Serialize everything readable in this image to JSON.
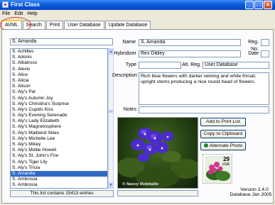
{
  "window": {
    "title": "First Class"
  },
  "menu": [
    "File",
    "Edit",
    "Help"
  ],
  "tabs": [
    "AVML",
    "Search",
    "Print",
    "User Database",
    "Update Database"
  ],
  "search": {
    "value": "S. Amanda"
  },
  "list": {
    "items": [
      "S. Achilles",
      "S. Adonis",
      "S. Albatross",
      "S. Alexis",
      "S. Alice",
      "S. Alicia",
      "S. Alison",
      "S. Aly's Pal",
      "S. Aly's Autumn Joy",
      "S. Aly's Christina's Surprise",
      "S. Aly's Cupids Kiss",
      "S. Aly's Evening Serenade",
      "S. Aly's Lady Elizabeth",
      "S. Aly's Magnetosphere",
      "S. Aly's Maitland Skies",
      "S. Aly's Michelle Lee",
      "S. Aly's Mikey",
      "S. Aly's Mollie Howell",
      "S. Aly's St. John's Fire",
      "S. Aly's Tiger Lily",
      "S. Aly's Tricia",
      "S. Amanda",
      "S. Ambrosia",
      "S. Ambrosia",
      "S. Amethyst"
    ],
    "selected_index": 21,
    "count_text": "This list contains 15413 entries"
  },
  "fields": {
    "name_label": "Name",
    "name": "S. Amanda",
    "reg_no_label": "Reg. No.",
    "reg_no": "",
    "hybridizer_label": "Hybridizer",
    "hybridizer": "Rex Dibley",
    "date_label": "Date",
    "date": "",
    "type_label": "Type",
    "type": "",
    "alt_reg_label": "Alt. Reg.",
    "alt_reg": "User Database",
    "description_label": "Description",
    "description": "Rich blue flowers with darker veining and white throat; upright stems producing a nice round head of flowers.",
    "notes_label": "Notes",
    "notes": ""
  },
  "photo": {
    "caption": "© Nancy Robitaille"
  },
  "buttons": {
    "add_print": "Add to Print List",
    "copy_clipboard": "Copy to Clipboard",
    "alt_photo": "Alternate Photo"
  },
  "stamp": {
    "value": "29",
    "country": "USA"
  },
  "version": {
    "version": "Version 2.4.0",
    "database": "Database Jan 2005"
  },
  "colors": {
    "selection": "#316ac5",
    "flower": "#4b2bd0",
    "titlebar": "#0a5bd8",
    "circle": "#e0302a"
  }
}
